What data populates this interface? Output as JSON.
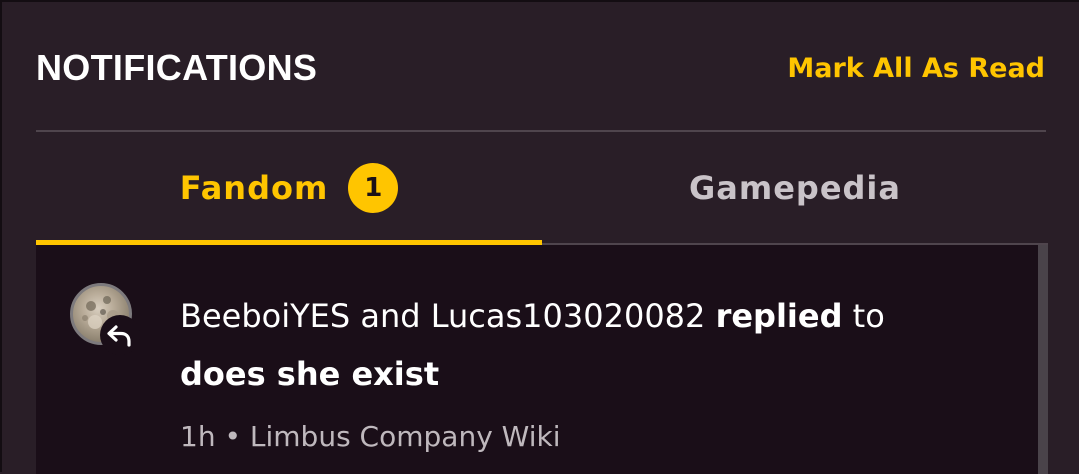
{
  "header": {
    "title": "NOTIFICATIONS",
    "mark_all_label": "Mark All As Read"
  },
  "tabs": [
    {
      "label": "Fandom",
      "badge": "1",
      "active": true
    },
    {
      "label": "Gamepedia",
      "active": false
    }
  ],
  "notifications": [
    {
      "actors": "BeeboiYES and Lucas103020082",
      "action": "replied",
      "connector": "to",
      "target": "does she exist",
      "time": "1h",
      "separator": "•",
      "wiki": "Limbus Company Wiki",
      "icon": "reply-icon",
      "avatar": "user-avatar"
    }
  ],
  "colors": {
    "background": "#291e27",
    "list_background": "#1a0e18",
    "accent": "#ffc500",
    "text": "#ffffff",
    "muted_text": "#bfb8bd",
    "inactive_tab": "#c9c3c8"
  }
}
